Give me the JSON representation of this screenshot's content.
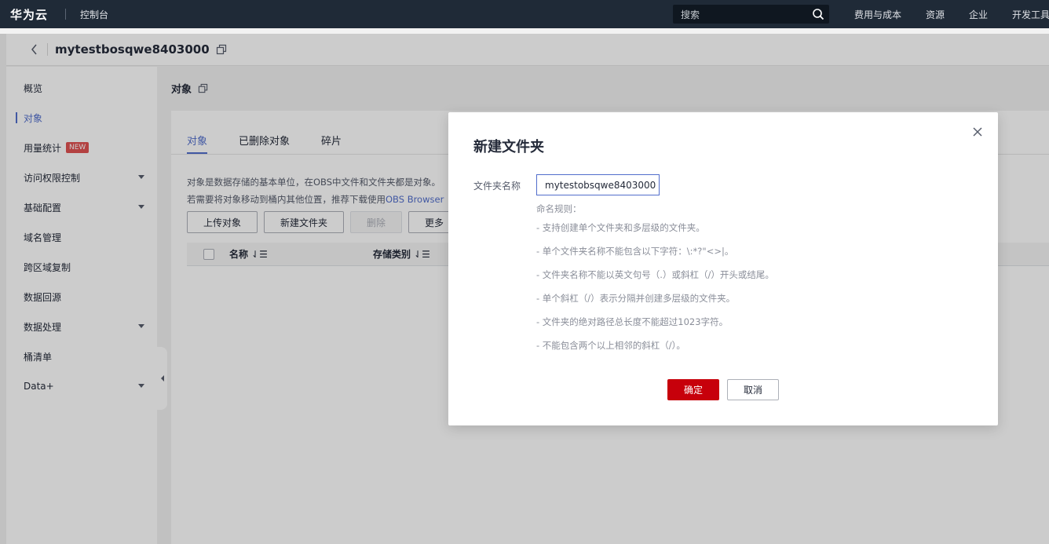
{
  "topbar": {
    "logo": "华为云",
    "console": "控制台",
    "search_placeholder": "搜索",
    "nav": [
      "费用与成本",
      "资源",
      "企业",
      "开发工具"
    ]
  },
  "bucket": {
    "name": "mytestbosqwe8403000"
  },
  "sidebar": {
    "items": [
      {
        "label": "概览"
      },
      {
        "label": "对象",
        "active": true
      },
      {
        "label": "用量统计",
        "badge": "NEW"
      },
      {
        "label": "访问权限控制",
        "expandable": true
      },
      {
        "label": "基础配置",
        "expandable": true
      },
      {
        "label": "域名管理"
      },
      {
        "label": "跨区域复制"
      },
      {
        "label": "数据回源"
      },
      {
        "label": "数据处理",
        "expandable": true
      },
      {
        "label": "桶清单"
      },
      {
        "label": "Data+",
        "expandable": true
      }
    ]
  },
  "main": {
    "title": "对象",
    "tabs": [
      "对象",
      "已删除对象",
      "碎片"
    ],
    "desc_line1": "对象是数据存储的基本单位，在OBS中文件和文件夹都是对象。",
    "desc_line2_prefix": "若需要将对象移动到桶内其他位置，推荐下载使用",
    "desc_line2_link": "OBS Browser",
    "toolbar": {
      "upload": "上传对象",
      "new_folder": "新建文件夹",
      "delete": "删除",
      "more": "更多"
    },
    "columns": [
      "名称",
      "存储类别"
    ]
  },
  "modal": {
    "title": "新建文件夹",
    "field_label": "文件夹名称",
    "field_value": "mytestobsqwe8403000",
    "rules_title": "命名规则：",
    "rules": [
      "- 支持创建单个文件夹和多层级的文件夹。",
      "- 单个文件夹名称不能包含以下字符：\\:*?\"<>|。",
      "- 文件夹名称不能以英文句号（.）或斜杠（/）开头或结尾。",
      "- 单个斜杠（/）表示分隔并创建多层级的文件夹。",
      "- 文件夹的绝对路径总长度不能超过1023字符。",
      "- 不能包含两个以上相邻的斜杠（/）。"
    ],
    "ok": "确定",
    "cancel": "取消"
  },
  "colors": {
    "topbar_bg": "#1f2a37",
    "accent": "#526ecc",
    "primary_button": "#c7000b",
    "badge": "#e05252"
  }
}
